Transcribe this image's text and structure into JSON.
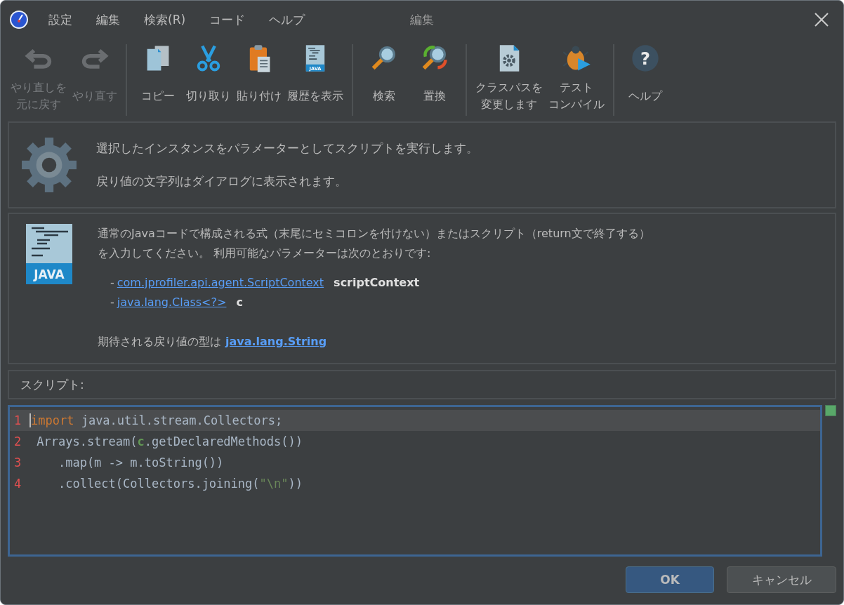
{
  "window": {
    "title": "編集"
  },
  "menu": [
    "設定",
    "編集",
    "検索(R)",
    "コード",
    "ヘルプ"
  ],
  "toolbar": [
    [
      {
        "label": [
          "やり直しを",
          "元に戻す"
        ],
        "disabled": true
      },
      {
        "label": [
          "やり直す"
        ],
        "disabled": true
      }
    ],
    [
      {
        "label": [
          "コピー"
        ],
        "disabled": false
      },
      {
        "label": [
          "切り取り"
        ],
        "disabled": false
      },
      {
        "label": [
          "貼り付け"
        ],
        "disabled": false
      },
      {
        "label": [
          "履歴を表示"
        ],
        "icon_text": "JAVA",
        "disabled": false
      }
    ],
    [
      {
        "label": [
          "検索"
        ],
        "disabled": false
      },
      {
        "label": [
          "置換"
        ],
        "disabled": false
      }
    ],
    [
      {
        "label": [
          "クラスパスを",
          "変更します"
        ],
        "disabled": false
      },
      {
        "label": [
          "テスト",
          "コンパイル"
        ],
        "disabled": false
      }
    ],
    [
      {
        "label": [
          "ヘルプ"
        ],
        "icon_text": "?",
        "disabled": false
      }
    ]
  ],
  "info": {
    "lines": [
      "選択したインスタンスをパラメーターとしてスクリプトを実行します。",
      "戻り値の文字列はダイアログに表示されます。"
    ]
  },
  "description": {
    "icon_text": "JAVA",
    "lines": [
      "通常のJavaコードで構成される式（末尾にセミコロンを付けない）またはスクリプト（return文で終了する）",
      "を入力してください。 利用可能なパラメーターは次のとおりです:"
    ],
    "parameters": [
      {
        "bullet": "-",
        "type": "com.jprofiler.api.agent.ScriptContext",
        "name": "scriptContext"
      },
      {
        "bullet": "-",
        "type": "java.lang.Class<?>",
        "name": "c"
      }
    ],
    "return_prefix": "期待される戻り値の型は",
    "return_type": "java.lang.String"
  },
  "script_label": "スクリプト:",
  "editor": {
    "lines": [
      {
        "number": "1",
        "current": true,
        "tokens": [
          {
            "kind": "keyword",
            "text": "import"
          },
          {
            "kind": "plain",
            "text": " java.util.stream.Collectors;"
          }
        ]
      },
      {
        "number": "2",
        "current": false,
        "tokens": [
          {
            "kind": "plain",
            "text": " Arrays.stream("
          },
          {
            "kind": "param",
            "text": "c"
          },
          {
            "kind": "plain",
            "text": ".getDeclaredMethods())"
          }
        ]
      },
      {
        "number": "3",
        "current": false,
        "tokens": [
          {
            "kind": "plain",
            "text": "    .map(m -> m.toString())"
          }
        ]
      },
      {
        "number": "4",
        "current": false,
        "tokens": [
          {
            "kind": "plain",
            "text": "    .collect(Collectors.joining("
          },
          {
            "kind": "string",
            "text": "\"\\n\""
          },
          {
            "kind": "plain",
            "text": "))"
          }
        ]
      }
    ]
  },
  "buttons": [
    {
      "label": "OK",
      "kind": "primary"
    },
    {
      "label": "キャンセル",
      "kind": "secondary"
    }
  ]
}
